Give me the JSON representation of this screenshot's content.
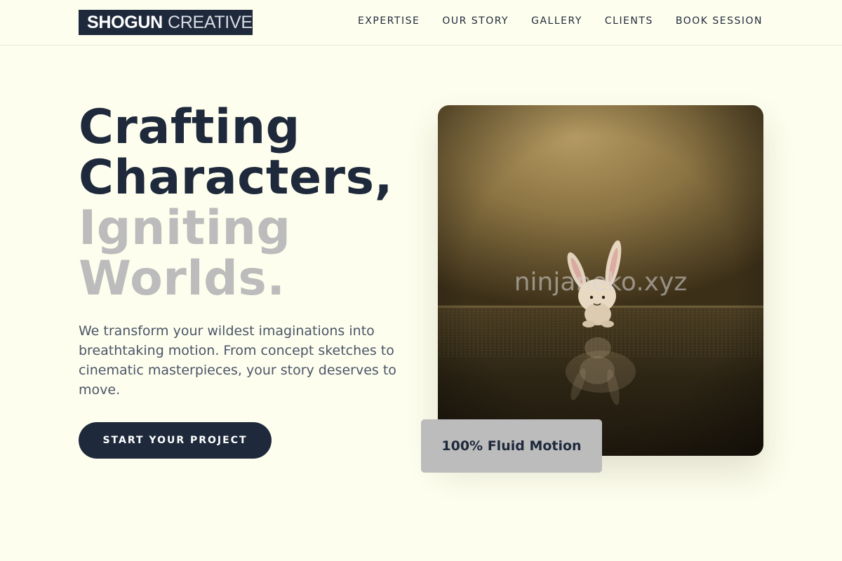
{
  "brand": {
    "bold": "SHOGUN",
    "light": "CREATIVE"
  },
  "nav": {
    "items": [
      {
        "label": "EXPERTISE"
      },
      {
        "label": "OUR STORY"
      },
      {
        "label": "GALLERY"
      },
      {
        "label": "CLIENTS"
      },
      {
        "label": "BOOK SESSION"
      }
    ]
  },
  "hero": {
    "headline_line1": "Crafting",
    "headline_line2": "Characters,",
    "headline_line3": "Igniting",
    "headline_line4": "Worlds.",
    "description": "We transform your wildest imaginations into breathtaking motion. From concept sketches to cinematic masterpieces, your story deserves to move.",
    "cta_label": "START YOUR PROJECT",
    "image_watermark": "ninjaneko.xyz",
    "badge_label": "100% Fluid Motion"
  },
  "colors": {
    "background": "#fefeee",
    "primary": "#1e293b",
    "headline_muted": "#bcbcbc",
    "body_text": "#4a5568",
    "badge_bg": "#bcbcbc"
  }
}
